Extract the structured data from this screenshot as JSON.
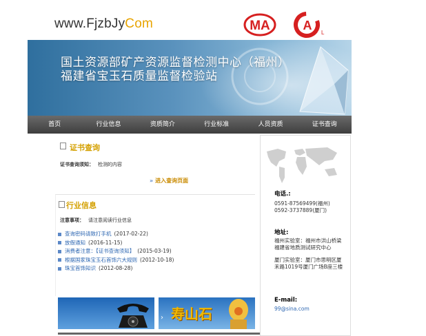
{
  "logo": {
    "main": "www.FjzbJy",
    "tail": "Com"
  },
  "certs": {
    "ma": "MA",
    "cal": "CAL",
    "ma_color": "#d62020",
    "cal_color": "#d62020"
  },
  "banner": {
    "title1": "国土资源部矿产资源监督检测中心（福州）",
    "title2": "福建省宝玉石质量监督检验站"
  },
  "nav": {
    "items": [
      "首页",
      "行业信息",
      "资质简介",
      "行业标准",
      "人员资质",
      "证书查询"
    ]
  },
  "cert_query": {
    "title": "证书查询",
    "label": "证书查询须知：",
    "value": "检测的内容",
    "enter": "进入查询页面"
  },
  "industry": {
    "title": "行业信息",
    "label": "注意事项：",
    "value": "请注意阅读行业信息",
    "items": [
      {
        "title": "查询密码请致打手机",
        "date": "(2017-02-22)"
      },
      {
        "title": "放假通知",
        "date": "(2016-11-15)"
      },
      {
        "title": "消费者注意：【证书查询须知】",
        "date": "(2015-03-19)"
      },
      {
        "title": "根据国家珠宝玉石首饰六大规则",
        "date": "(2012-10-18)"
      },
      {
        "title": "珠宝首饰知识",
        "date": "(2012-08-28)"
      }
    ]
  },
  "ads": {
    "shoushan": "寿山石"
  },
  "contact": {
    "phone_label": "电话.:",
    "phone1": "0591-87569499(福州)",
    "phone2": "0592-3737889(厦门)",
    "address_label": "地址:",
    "address1": "福州实验室：福州市洪山桥梁福建省地质测试研究中心",
    "address2": "厦门实验室：厦门市思明区厦禾路1019号厦门广场B座三楼",
    "email_label": "E-mail:",
    "email": "99@sina.com"
  }
}
